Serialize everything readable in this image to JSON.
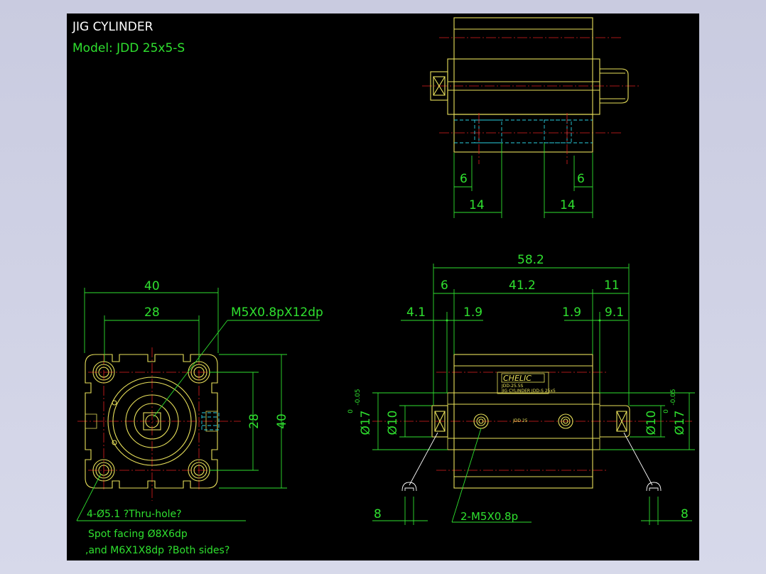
{
  "title": "JIG CYLINDER",
  "model": "Model:  JDD 25x5-S",
  "dims": {
    "d40_top": "40",
    "d28_top": "28",
    "thread_label": "M5X0.8pX12dp",
    "d28_side": "28",
    "d40_side": "40",
    "hole_note": "4-Ø5.1 ?Thru-hole?",
    "spot_note": "Spot facing  Ø8X6dp",
    "and_note": ",and M6X1X8dp ?Both sides?",
    "top_6_left": "6",
    "top_6_right": "6",
    "top_14_left": "14",
    "top_14_right": "14",
    "d58_2": "58.2",
    "d6": "6",
    "d41_2": "41.2",
    "d11": "11",
    "d4_1": "4.1",
    "d1_9_left": "1.9",
    "d1_9_right": "1.9",
    "d9_1": "9.1",
    "phi17_left": "Ø17",
    "phi17_tol_left": "-0.05",
    "phi17_zero_left": "0",
    "phi10_left": "Ø10",
    "phi10_right": "Ø10",
    "phi17_right": "Ø17",
    "phi17_tol_right": "-0.05",
    "phi17_zero_right": "0",
    "d8_left": "8",
    "d8_right": "8",
    "port_note": "2-M5X0.8p"
  },
  "label_plate": {
    "brand": "CHELIC",
    "line1": "JDD-25.5S",
    "line2": "JIG CYLINDER JDD-S 25x5",
    "body_mark": "JDD 25"
  },
  "colors": {
    "background": "#000000",
    "outline": "#e8e05a",
    "dimension": "#2fe02f",
    "centerline": "#e02020",
    "hidden": "#2ad0e0"
  }
}
